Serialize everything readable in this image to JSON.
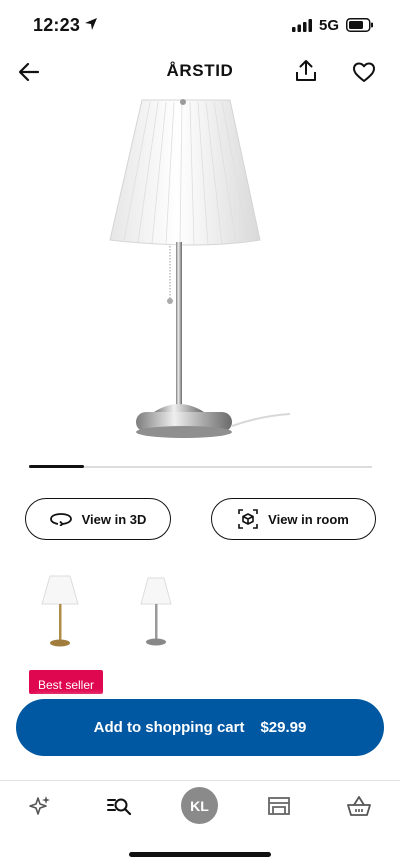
{
  "status": {
    "time": "12:23",
    "network": "5G"
  },
  "header": {
    "title": "ÅRSTID"
  },
  "carousel": {
    "progress": 0.16
  },
  "actions": {
    "view_3d_label": "View in 3D",
    "view_room_label": "View in room"
  },
  "badge": {
    "label": "Best seller"
  },
  "cart": {
    "label": "Add to shopping cart",
    "price": "$29.99"
  },
  "nav": {
    "avatar_initials": "KL"
  },
  "colors": {
    "accent": "#0058a3",
    "badge": "#e00751"
  }
}
